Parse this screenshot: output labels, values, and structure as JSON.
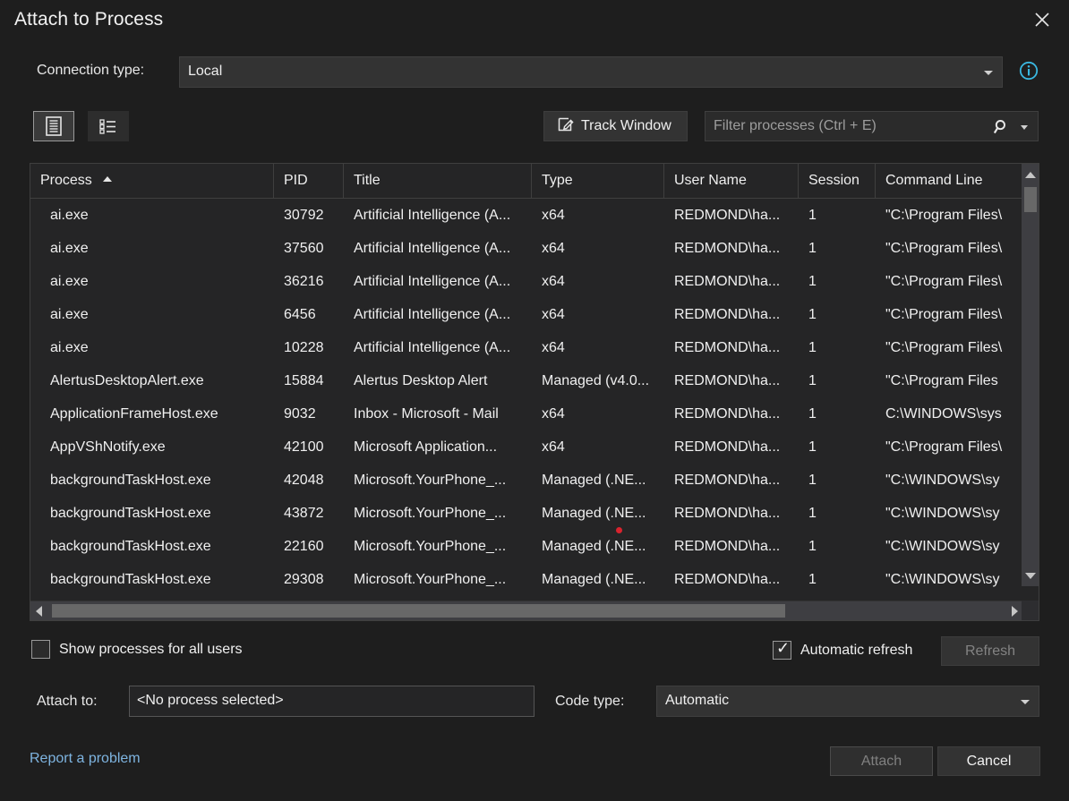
{
  "window": {
    "title": "Attach to Process",
    "close_icon": "close-icon"
  },
  "connection": {
    "label": "Connection type:",
    "value": "Local",
    "info_icon": "info-icon"
  },
  "toolbar": {
    "view_list_icon": "document-list-view-icon",
    "view_tree_icon": "grouped-list-view-icon",
    "track_window_label": "Track Window",
    "track_window_icon": "track-window-pen-icon",
    "filter_placeholder": "Filter processes (Ctrl + E)",
    "filter_value": "",
    "search_icon": "search-icon",
    "filter_dropdown_icon": "chevron-down-icon"
  },
  "grid": {
    "columns": [
      {
        "label": "Process",
        "sorted": "asc"
      },
      {
        "label": "PID",
        "sorted": ""
      },
      {
        "label": "Title",
        "sorted": ""
      },
      {
        "label": "Type",
        "sorted": ""
      },
      {
        "label": "User Name",
        "sorted": ""
      },
      {
        "label": "Session",
        "sorted": ""
      },
      {
        "label": "Command Line",
        "sorted": ""
      }
    ],
    "rows": [
      {
        "process": "ai.exe",
        "pid": "30792",
        "title": "Artificial Intelligence (A...",
        "type": "x64",
        "user": "REDMOND\\ha...",
        "session": "1",
        "cmd": "\"C:\\Program Files\\"
      },
      {
        "process": "ai.exe",
        "pid": "37560",
        "title": "Artificial Intelligence (A...",
        "type": "x64",
        "user": "REDMOND\\ha...",
        "session": "1",
        "cmd": "\"C:\\Program Files\\"
      },
      {
        "process": "ai.exe",
        "pid": "36216",
        "title": "Artificial Intelligence (A...",
        "type": "x64",
        "user": "REDMOND\\ha...",
        "session": "1",
        "cmd": "\"C:\\Program Files\\"
      },
      {
        "process": "ai.exe",
        "pid": "6456",
        "title": "Artificial Intelligence (A...",
        "type": "x64",
        "user": "REDMOND\\ha...",
        "session": "1",
        "cmd": "\"C:\\Program Files\\"
      },
      {
        "process": "ai.exe",
        "pid": "10228",
        "title": "Artificial Intelligence (A...",
        "type": "x64",
        "user": "REDMOND\\ha...",
        "session": "1",
        "cmd": "\"C:\\Program Files\\"
      },
      {
        "process": "AlertusDesktopAlert.exe",
        "pid": "15884",
        "title": "Alertus Desktop Alert",
        "type": "Managed (v4.0...",
        "user": "REDMOND\\ha...",
        "session": "1",
        "cmd": "\"C:\\Program Files"
      },
      {
        "process": "ApplicationFrameHost.exe",
        "pid": "9032",
        "title": "Inbox - Microsoft - Mail",
        "type": "x64",
        "user": "REDMOND\\ha...",
        "session": "1",
        "cmd": "C:\\WINDOWS\\sys"
      },
      {
        "process": "AppVShNotify.exe",
        "pid": "42100",
        "title": "Microsoft Application...",
        "type": "x64",
        "user": "REDMOND\\ha...",
        "session": "1",
        "cmd": "\"C:\\Program Files\\"
      },
      {
        "process": "backgroundTaskHost.exe",
        "pid": "42048",
        "title": "Microsoft.YourPhone_...",
        "type": "Managed (.NE...",
        "user": "REDMOND\\ha...",
        "session": "1",
        "cmd": "\"C:\\WINDOWS\\sy"
      },
      {
        "process": "backgroundTaskHost.exe",
        "pid": "43872",
        "title": "Microsoft.YourPhone_...",
        "type": "Managed (.NE...",
        "user": "REDMOND\\ha...",
        "session": "1",
        "cmd": "\"C:\\WINDOWS\\sy"
      },
      {
        "process": "backgroundTaskHost.exe",
        "pid": "22160",
        "title": "Microsoft.YourPhone_...",
        "type": "Managed (.NE...",
        "user": "REDMOND\\ha...",
        "session": "1",
        "cmd": "\"C:\\WINDOWS\\sy"
      },
      {
        "process": "backgroundTaskHost.exe",
        "pid": "29308",
        "title": "Microsoft.YourPhone_...",
        "type": "Managed (.NE...",
        "user": "REDMOND\\ha...",
        "session": "1",
        "cmd": "\"C:\\WINDOWS\\sy"
      }
    ],
    "vertical_scrollbar": {
      "up_icon": "scroll-up-arrow-icon",
      "down_icon": "scroll-down-arrow-icon"
    },
    "horizontal_scrollbar": {
      "left_icon": "scroll-left-arrow-icon",
      "right_icon": "scroll-right-arrow-icon"
    }
  },
  "options": {
    "show_all_users_label": "Show processes for all users",
    "show_all_users_checked": false,
    "automatic_refresh_label": "Automatic refresh",
    "automatic_refresh_checked": true,
    "automatic_refresh_mark": "✓",
    "refresh_label": "Refresh",
    "refresh_enabled": false
  },
  "attach": {
    "label": "Attach to:",
    "value": "<No process selected>",
    "code_type_label": "Code type:",
    "code_type_value": "Automatic"
  },
  "footer": {
    "report_link": "Report a problem",
    "attach_label": "Attach",
    "attach_enabled": false,
    "cancel_label": "Cancel"
  },
  "colors": {
    "background": "#1e1e1e",
    "grid_background": "#252526",
    "control_background": "#333333",
    "border": "#3f3f3f",
    "link": "#7eb4e0",
    "info_icon": "#3ab7e0",
    "scrollbar_track": "#3e3e42",
    "scrollbar_thumb": "#686868",
    "disabled_text": "#808080",
    "cursor_dot": "#d9232e"
  }
}
